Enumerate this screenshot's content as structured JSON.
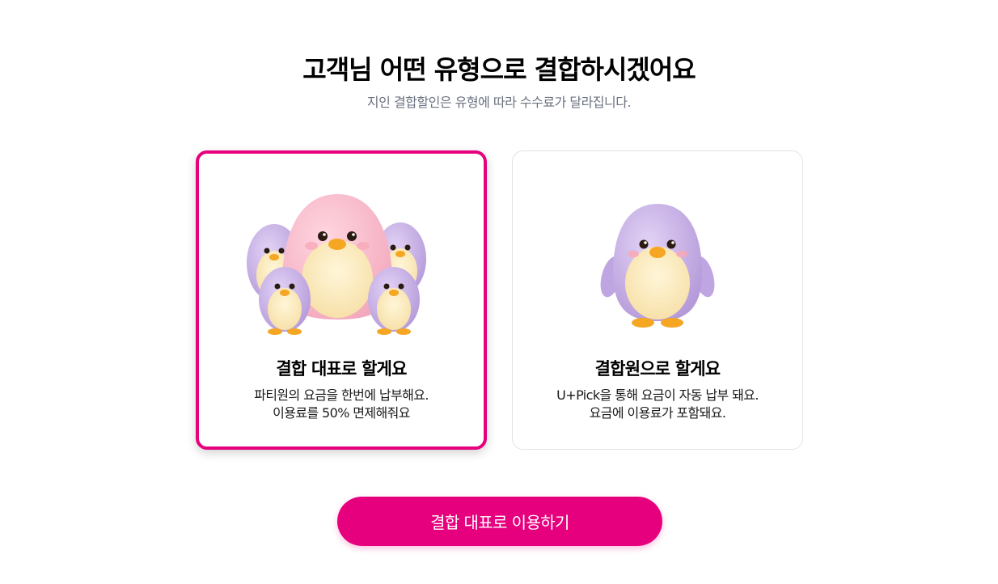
{
  "header": {
    "title": "고객님 어떤 유형으로 결합하시겠어요",
    "subtitle": "지인 결합할인은 유형에 따라 수수료가 달라집니다."
  },
  "options": [
    {
      "title": "결합 대표로 할게요",
      "description": [
        "파티원의 요금을 한번에 납부해요.",
        "이용료를 50% 면제해줘요"
      ],
      "selected": true,
      "illustration": "penguin-group-icon"
    },
    {
      "title": "결합원으로 할게요",
      "description": [
        "U+Pick을 통해 요금이 자동 납부 돼요.",
        "요금에 이용료가 포함돼요."
      ],
      "selected": false,
      "illustration": "penguin-single-icon"
    }
  ],
  "cta": {
    "label": "결합 대표로 이용하기"
  },
  "colors": {
    "accent": "#e6007e",
    "subtitle_text": "#6b7280",
    "card_border": "#e3e3e3",
    "penguin_purple": "#c8b0e8",
    "penguin_pink": "#f6b8c8",
    "penguin_belly": "#fbe9b5",
    "beak_orange": "#f5a623"
  }
}
